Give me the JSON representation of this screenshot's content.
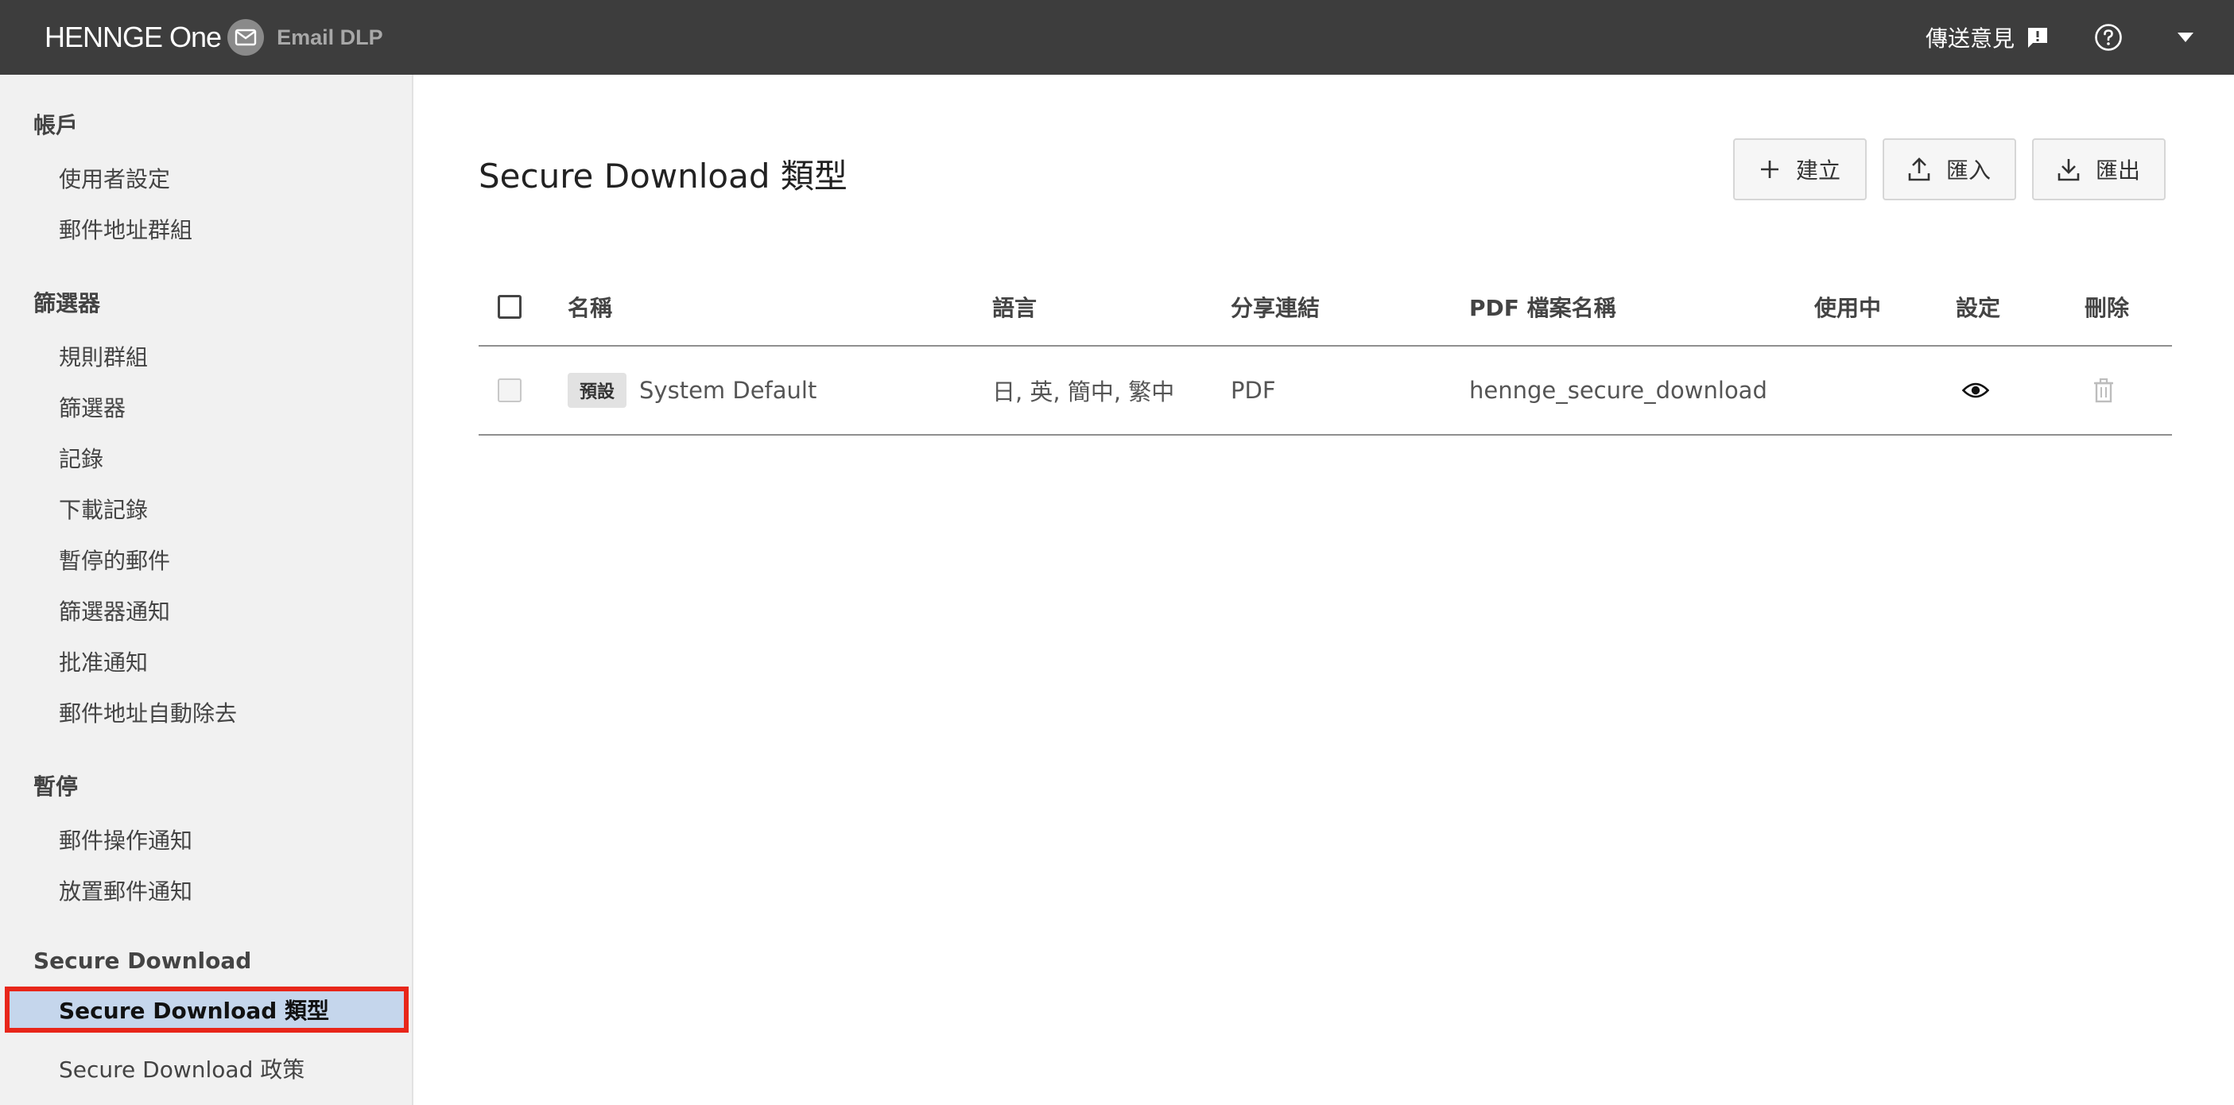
{
  "header": {
    "brand": "HENNGE One",
    "product": "Email DLP",
    "feedback_label": "傳送意見",
    "help_icon": "help-circle-icon",
    "menu_icon": "caret-down-icon"
  },
  "sidebar": {
    "sections": [
      {
        "heading": "帳戶",
        "items": [
          "使用者設定",
          "郵件地址群組"
        ]
      },
      {
        "heading": "篩選器",
        "items": [
          "規則群組",
          "篩選器",
          "記錄",
          "下載記錄",
          "暫停的郵件",
          "篩選器通知",
          "批准通知",
          "郵件地址自動除去"
        ]
      },
      {
        "heading": "暫停",
        "items": [
          "郵件操作通知",
          "放置郵件通知"
        ]
      },
      {
        "heading": "Secure Download",
        "items": [
          "Secure Download 類型",
          "Secure Download 政策"
        ]
      }
    ],
    "active_item": "Secure Download 類型"
  },
  "main": {
    "title": "Secure Download 類型",
    "buttons": {
      "create": "建立",
      "import": "匯入",
      "export": "匯出"
    },
    "table": {
      "headers": {
        "name": "名稱",
        "language": "語言",
        "share_link": "分享連結",
        "pdf_filename": "PDF 檔案名稱",
        "in_use": "使用中",
        "settings": "設定",
        "delete": "刪除"
      },
      "rows": [
        {
          "badge": "預設",
          "name": "System Default",
          "language": "日, 英, 簡中, 繁中",
          "share_link": "PDF",
          "pdf_filename": "hennge_secure_download",
          "in_use": "",
          "settings_icon": "eye-icon",
          "delete_icon": "trash-icon"
        }
      ]
    }
  },
  "colors": {
    "topbar": "#3d3d3d",
    "sidebar_bg": "#f1f1f1",
    "active_bg": "#c5d6ec",
    "highlight_border": "#e8261a"
  }
}
